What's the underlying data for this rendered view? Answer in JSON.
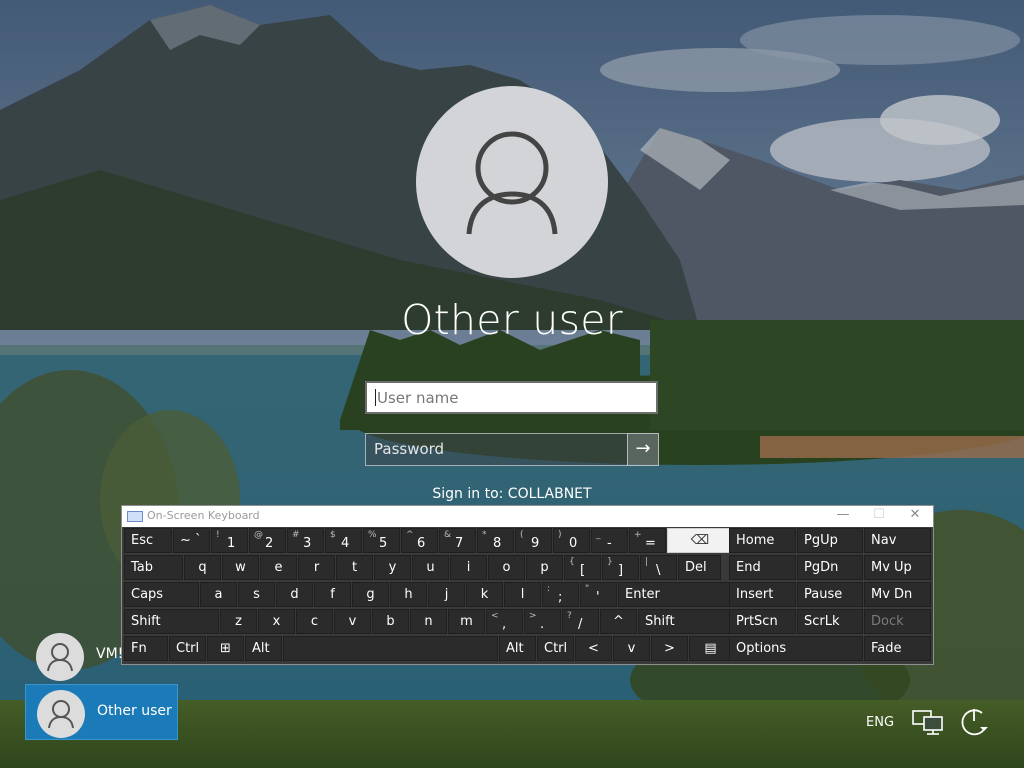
{
  "login": {
    "user_display_name": "Other user",
    "username_placeholder": "User name",
    "password_placeholder": "Password",
    "submit_glyph": "→",
    "sign_in_to": "Sign in to: COLLABNET"
  },
  "osk": {
    "title": "On-Screen Keyboard",
    "window_buttons": [
      "—",
      "☐",
      "✕"
    ],
    "rows": [
      {
        "keys": [
          {
            "main": "Esc"
          },
          {
            "main": "~ `"
          },
          {
            "alt": "!",
            "low": "1"
          },
          {
            "alt": "@",
            "low": "2"
          },
          {
            "alt": "#",
            "low": "3"
          },
          {
            "alt": "$",
            "low": "4"
          },
          {
            "alt": "%",
            "low": "5"
          },
          {
            "alt": "^",
            "low": "6"
          },
          {
            "alt": "&",
            "low": "7"
          },
          {
            "alt": "*",
            "low": "8"
          },
          {
            "alt": "(",
            "low": "9"
          },
          {
            "alt": ")",
            "low": "0"
          },
          {
            "alt": "_",
            "low": "-"
          },
          {
            "alt": "+",
            "low": "="
          },
          {
            "main": "⌫"
          }
        ]
      },
      {
        "keys": [
          {
            "main": "Tab"
          },
          {
            "main": "q"
          },
          {
            "main": "w"
          },
          {
            "main": "e"
          },
          {
            "main": "r"
          },
          {
            "main": "t"
          },
          {
            "main": "y"
          },
          {
            "main": "u"
          },
          {
            "main": "i"
          },
          {
            "main": "o"
          },
          {
            "main": "p"
          },
          {
            "alt": "{",
            "low": "["
          },
          {
            "alt": "}",
            "low": "]"
          },
          {
            "alt": "|",
            "low": "\\"
          },
          {
            "main": "Del"
          }
        ]
      },
      {
        "keys": [
          {
            "main": "Caps"
          },
          {
            "main": "a"
          },
          {
            "main": "s"
          },
          {
            "main": "d"
          },
          {
            "main": "f"
          },
          {
            "main": "g"
          },
          {
            "main": "h"
          },
          {
            "main": "j"
          },
          {
            "main": "k"
          },
          {
            "main": "l"
          },
          {
            "alt": ":",
            "low": ";"
          },
          {
            "alt": "\"",
            "low": "'"
          },
          {
            "main": "Enter"
          }
        ]
      },
      {
        "keys": [
          {
            "main": "Shift"
          },
          {
            "main": "z"
          },
          {
            "main": "x"
          },
          {
            "main": "c"
          },
          {
            "main": "v"
          },
          {
            "main": "b"
          },
          {
            "main": "n"
          },
          {
            "main": "m"
          },
          {
            "alt": "<",
            "low": ","
          },
          {
            "alt": ">",
            "low": "."
          },
          {
            "alt": "?",
            "low": "/"
          },
          {
            "main": "^"
          },
          {
            "main": "Shift"
          }
        ]
      },
      {
        "keys": [
          {
            "main": "Fn"
          },
          {
            "main": "Ctrl"
          },
          {
            "main": "⊞"
          },
          {
            "main": "Alt"
          },
          {
            "main": ""
          },
          {
            "main": "Alt"
          },
          {
            "main": "Ctrl"
          },
          {
            "main": "<"
          },
          {
            "main": "v"
          },
          {
            "main": ">"
          },
          {
            "main": "▤"
          }
        ]
      }
    ],
    "side_rows": [
      [
        "Home",
        "PgUp",
        "Nav"
      ],
      [
        "End",
        "PgDn",
        "Mv Up"
      ],
      [
        "Insert",
        "Pause",
        "Mv Dn"
      ],
      [
        "PrtScn",
        "ScrLk",
        "Dock"
      ],
      [
        "Options",
        "Fade"
      ]
    ]
  },
  "users": [
    {
      "label": "VM!",
      "selected": false
    },
    {
      "label": "Other user",
      "selected": true
    }
  ],
  "taskbar": {
    "language": "ENG"
  },
  "colors": {
    "selected_tile": "#1b7ab8",
    "osk_key": "#2b2b2b",
    "osk_pressed": "#f2f2f2"
  }
}
